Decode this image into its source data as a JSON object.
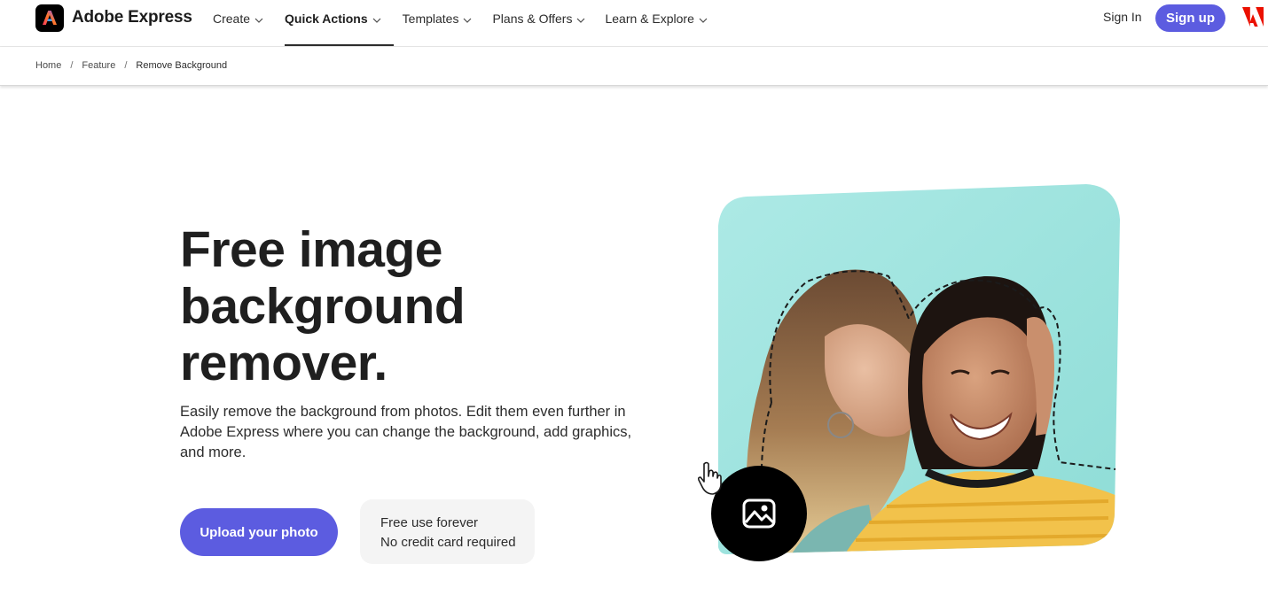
{
  "brand": {
    "name": "Adobe Express"
  },
  "nav": {
    "items": [
      {
        "label": "Create"
      },
      {
        "label": "Quick Actions"
      },
      {
        "label": "Templates"
      },
      {
        "label": "Plans & Offers"
      },
      {
        "label": "Learn & Explore"
      }
    ],
    "active_item": "Quick Actions",
    "sign_in": "Sign In",
    "sign_up": "Sign up"
  },
  "breadcrumb": {
    "items": [
      "Home",
      "Feature",
      "Remove Background"
    ],
    "separator": "/"
  },
  "hero": {
    "title_lines": [
      "Free image",
      "background",
      "remover."
    ],
    "description": "Easily remove the background from photos. Edit them even further in Adobe Express where you can change the background, add graphics, and more.",
    "upload_button": "Upload your photo",
    "perks": [
      "Free use forever",
      "No credit card required"
    ]
  },
  "colors": {
    "accent": "#5c5ce0",
    "adobe_red": "#eb1000",
    "teal_background": "#a8e8e2",
    "perk_background": "#f4f4f4"
  },
  "icons": {
    "image_upload": "image-icon",
    "cursor": "hand-cursor-icon"
  }
}
